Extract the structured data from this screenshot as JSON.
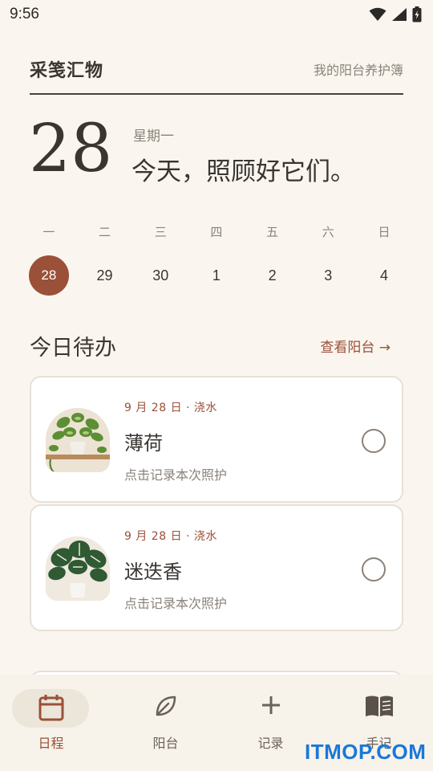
{
  "status_bar": {
    "time": "9:56",
    "icons": [
      "wifi-icon",
      "signal-icon",
      "battery-icon"
    ]
  },
  "header": {
    "title": "采笺汇物",
    "subtitle": "我的阳台养护簿"
  },
  "date": {
    "day": "28",
    "weekday": "星期一",
    "greeting": "今天，照顾好它们。"
  },
  "week": {
    "weekdays": [
      "一",
      "二",
      "三",
      "四",
      "五",
      "六",
      "日"
    ],
    "days": [
      "28",
      "29",
      "30",
      "1",
      "2",
      "3",
      "4"
    ],
    "selected_index": 0
  },
  "todo": {
    "title": "今日待办",
    "link": "查看阳台 →"
  },
  "tasks": [
    {
      "meta": "9 月 28 日 · 浇水",
      "name": "薄荷",
      "hint": "点击记录本次照护",
      "image": "pothos-plant-photo"
    },
    {
      "meta": "9 月 28 日 · 浇水",
      "name": "迷迭香",
      "hint": "点击记录本次照护",
      "image": "monstera-plant-photo"
    }
  ],
  "nav": {
    "items": [
      {
        "label": "日程",
        "icon": "calendar-icon",
        "active": true
      },
      {
        "label": "阳台",
        "icon": "leaf-icon",
        "active": false
      },
      {
        "label": "记录",
        "icon": "plus-icon",
        "active": false
      },
      {
        "label": "手记",
        "icon": "book-icon",
        "active": false
      }
    ]
  },
  "watermark": "ITMOP.COM",
  "colors": {
    "accent": "#9b5038",
    "background": "#faf6ef",
    "text": "#3a3530",
    "muted": "#8a837a"
  }
}
